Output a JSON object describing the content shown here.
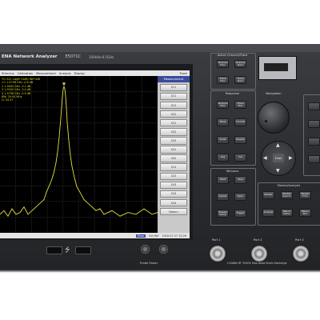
{
  "header": {
    "brand": "ENA Network Analyzer",
    "model": "E5071C",
    "freq": "100kHz-8.5GHz"
  },
  "menu": [
    "Stimulus",
    "Calibration",
    "Measurement",
    "Analysis",
    "Display"
  ],
  "menu_right": "Trace",
  "markers": [
    "Tr1 S21 LogM 10dB/ Ref 0dB",
    ">1 1.5796 GHz -0.8 dB",
    "2 1.5650 GHz -3.1 dB",
    "3 1.5940 GHz -3.0 dB",
    "4 1.5796 GHz -0.9 dB",
    "BW: 29.00 MHz",
    "Q: 54.47"
  ],
  "measurement": {
    "header": "Measurement",
    "softkeys": [
      "S11",
      "S21",
      "S12",
      "S22",
      "S31",
      "S32",
      "S33",
      "S41",
      "S42",
      "S13",
      "S23",
      "S43",
      "S34",
      "S44",
      "Return"
    ]
  },
  "status": {
    "mode": "Meas",
    "text": "Ext Ref",
    "timestamp": "2016-07-27 15:26"
  },
  "panel": {
    "active_channel_title": "Active Channel/Trace",
    "active_channel_keys": [
      "Channel Prev",
      "Channel Next",
      "Trace Prev",
      "Trace Next"
    ],
    "response_title": "Response",
    "response_keys": [
      "Channel Max",
      "Trace Max",
      "Meas",
      "Format",
      "Scale",
      "Display",
      "Avg",
      "Cal"
    ],
    "navigation_title": "Navigation",
    "stimulus_title": "Stimulus",
    "stimulus_keys": [
      "Start",
      "Stop",
      "Center",
      "Span",
      "Sweep Setup",
      "Trigger"
    ],
    "marker_title": "Marker/Analysis",
    "marker_keys": [
      "Marker",
      "Marker Search",
      "Marker Fctn",
      "Analysis",
      "Macro Setup",
      "Macro Run"
    ],
    "enter": "Enter",
    "probe_power": "Probe Power",
    "ports": [
      "Port 1",
      "Port 2",
      "Port 3"
    ],
    "warning": "+20dBm RF 35VDC Max  Avoid Static Discharge"
  },
  "chart_data": {
    "type": "line",
    "series": [
      {
        "x": [
          0,
          5,
          10,
          15,
          20,
          25,
          30,
          35,
          40,
          45,
          50,
          55,
          58,
          61,
          64,
          67,
          70,
          72,
          74,
          76,
          77,
          78,
          79,
          80,
          81,
          82,
          83,
          84,
          86,
          88,
          90,
          93,
          96,
          100,
          105,
          110,
          115,
          120,
          125,
          130,
          140,
          150,
          160,
          170,
          180,
          190,
          197
        ],
        "y": [
          -70,
          -68,
          -71,
          -67,
          -70,
          -69,
          -66,
          -70,
          -68,
          -66,
          -64,
          -62,
          -58,
          -55,
          -52,
          -48,
          -42,
          -36,
          -28,
          -18,
          -12,
          -6,
          -2,
          -0.8,
          -2,
          -6,
          -12,
          -20,
          -30,
          -38,
          -44,
          -50,
          -55,
          -58,
          -62,
          -64,
          -66,
          -68,
          -67,
          -70,
          -68,
          -71,
          -69,
          -70,
          -67,
          -70,
          -69
        ]
      }
    ],
    "ylim": [
      -80,
      5
    ],
    "xlim": [
      0,
      197
    ],
    "grid": true
  }
}
